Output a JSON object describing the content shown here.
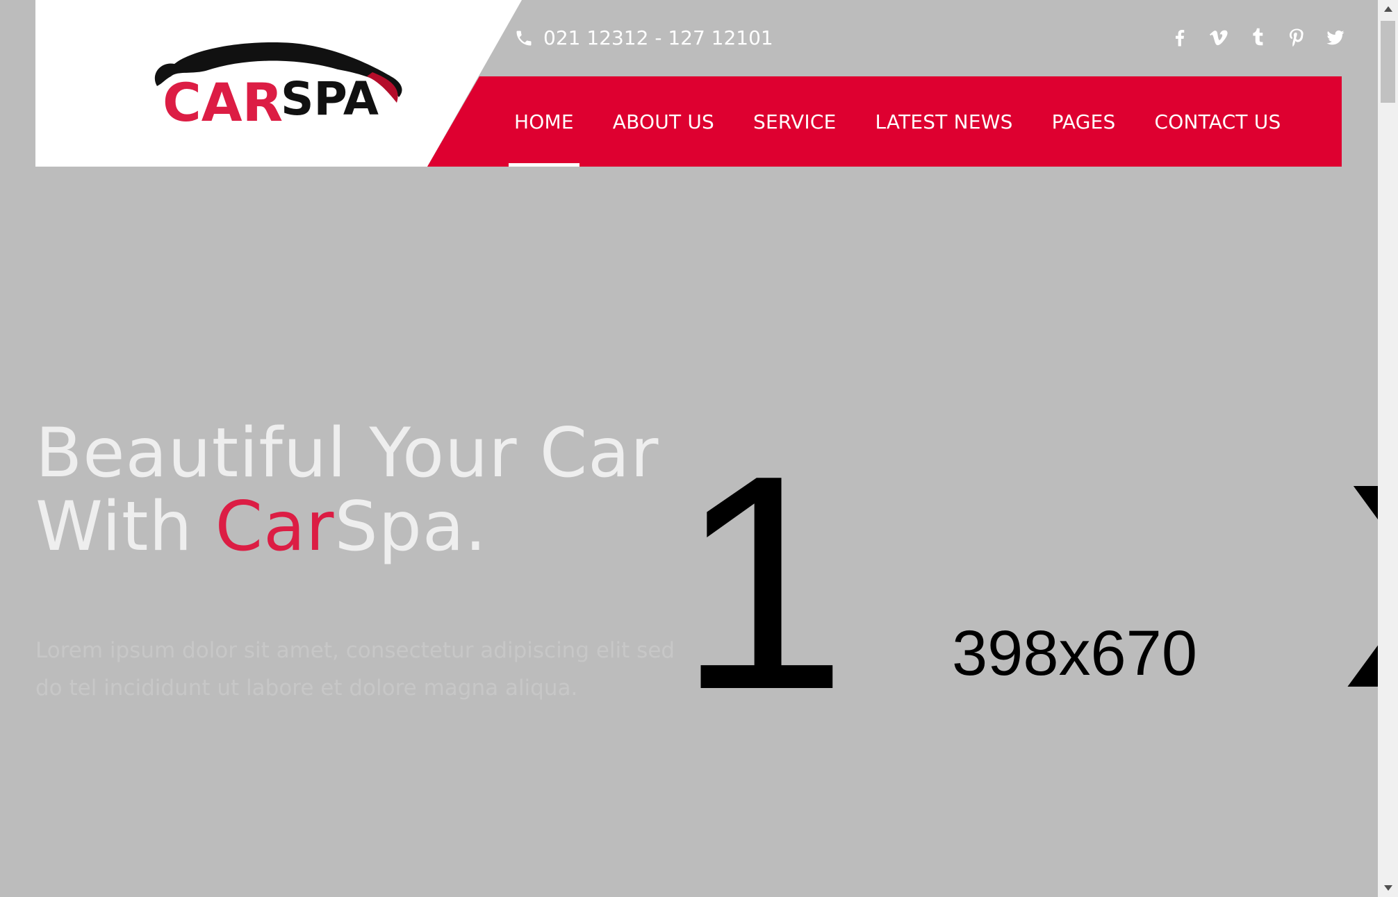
{
  "brand": {
    "logo_text_car": "CAR",
    "logo_text_spa": "SPA"
  },
  "header": {
    "phone": "021 12312 - 127 12101",
    "social_icons": [
      "facebook-icon",
      "vimeo-icon",
      "tumblr-icon",
      "pinterest-icon",
      "twitter-icon"
    ]
  },
  "nav": {
    "items": [
      {
        "label": "HOME",
        "active": true
      },
      {
        "label": "ABOUT US"
      },
      {
        "label": "SERVICE"
      },
      {
        "label": "LATEST NEWS"
      },
      {
        "label": "PAGES"
      },
      {
        "label": "CONTACT US"
      }
    ]
  },
  "hero": {
    "title_line1": "Beautiful Your Car",
    "title_line2_prefix": "With ",
    "title_line2_accent": "Car",
    "title_line2_suffix": "Spa.",
    "description": "Lorem ipsum dolor sit amet, consectetur adipiscing elit sed do tel incididunt ut labore et dolore magna aliqua.",
    "placeholder_number": "1",
    "placeholder_size": "398x670",
    "placeholder_glyph": "X"
  },
  "colors": {
    "accent": "#de0030",
    "hero_bg": "#bcbcbc",
    "accent_text": "#dc1d44"
  }
}
